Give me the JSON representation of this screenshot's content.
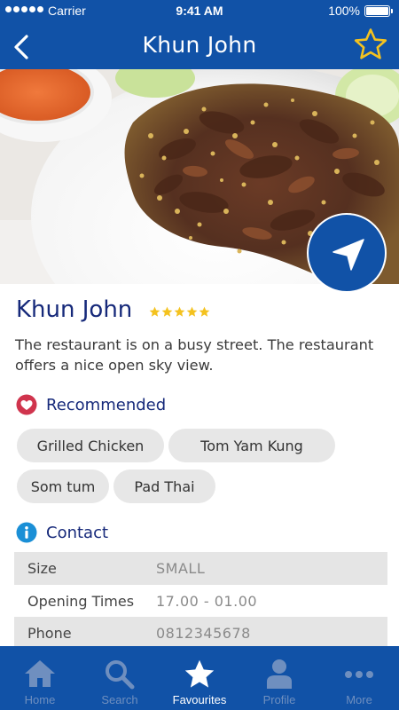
{
  "status_bar": {
    "carrier": "Carrier",
    "time": "9:41 AM",
    "battery": "100%"
  },
  "nav": {
    "title": "Khun John",
    "back_icon": "chevron-left-icon",
    "favorite_icon": "star-outline-icon",
    "favorite_color": "#f4c21f"
  },
  "hero": {
    "image": "grilled-meat-dish-photo",
    "fab_icon": "navigation-arrow-icon"
  },
  "restaurant": {
    "name": "Khun John",
    "rating": 5,
    "rating_max": 5,
    "description": "The restaurant is on a busy street. The restaurant offers a nice open sky view."
  },
  "recommended": {
    "heading": "Recommended",
    "icon": "heart-icon",
    "items": [
      "Grilled Chicken",
      "Tom Yam Kung",
      "Som tum",
      "Pad Thai"
    ]
  },
  "contact": {
    "heading": "Contact",
    "icon": "info-icon",
    "rows": [
      {
        "label": "Size",
        "value": "SMALL"
      },
      {
        "label": "Opening Times",
        "value": "17.00 - 01.00"
      },
      {
        "label": "Phone",
        "value": "0812345678"
      }
    ]
  },
  "tabs": [
    {
      "label": "Home",
      "icon": "home-icon"
    },
    {
      "label": "Search",
      "icon": "search-icon"
    },
    {
      "label": "Favourites",
      "icon": "star-icon",
      "active": true
    },
    {
      "label": "Profile",
      "icon": "profile-icon"
    },
    {
      "label": "More",
      "icon": "more-icon"
    }
  ],
  "colors": {
    "primary": "#1152a7",
    "title_text": "#16297a",
    "star": "#f4c21f",
    "heart": "#d0344d",
    "info": "#1a8fd6"
  }
}
